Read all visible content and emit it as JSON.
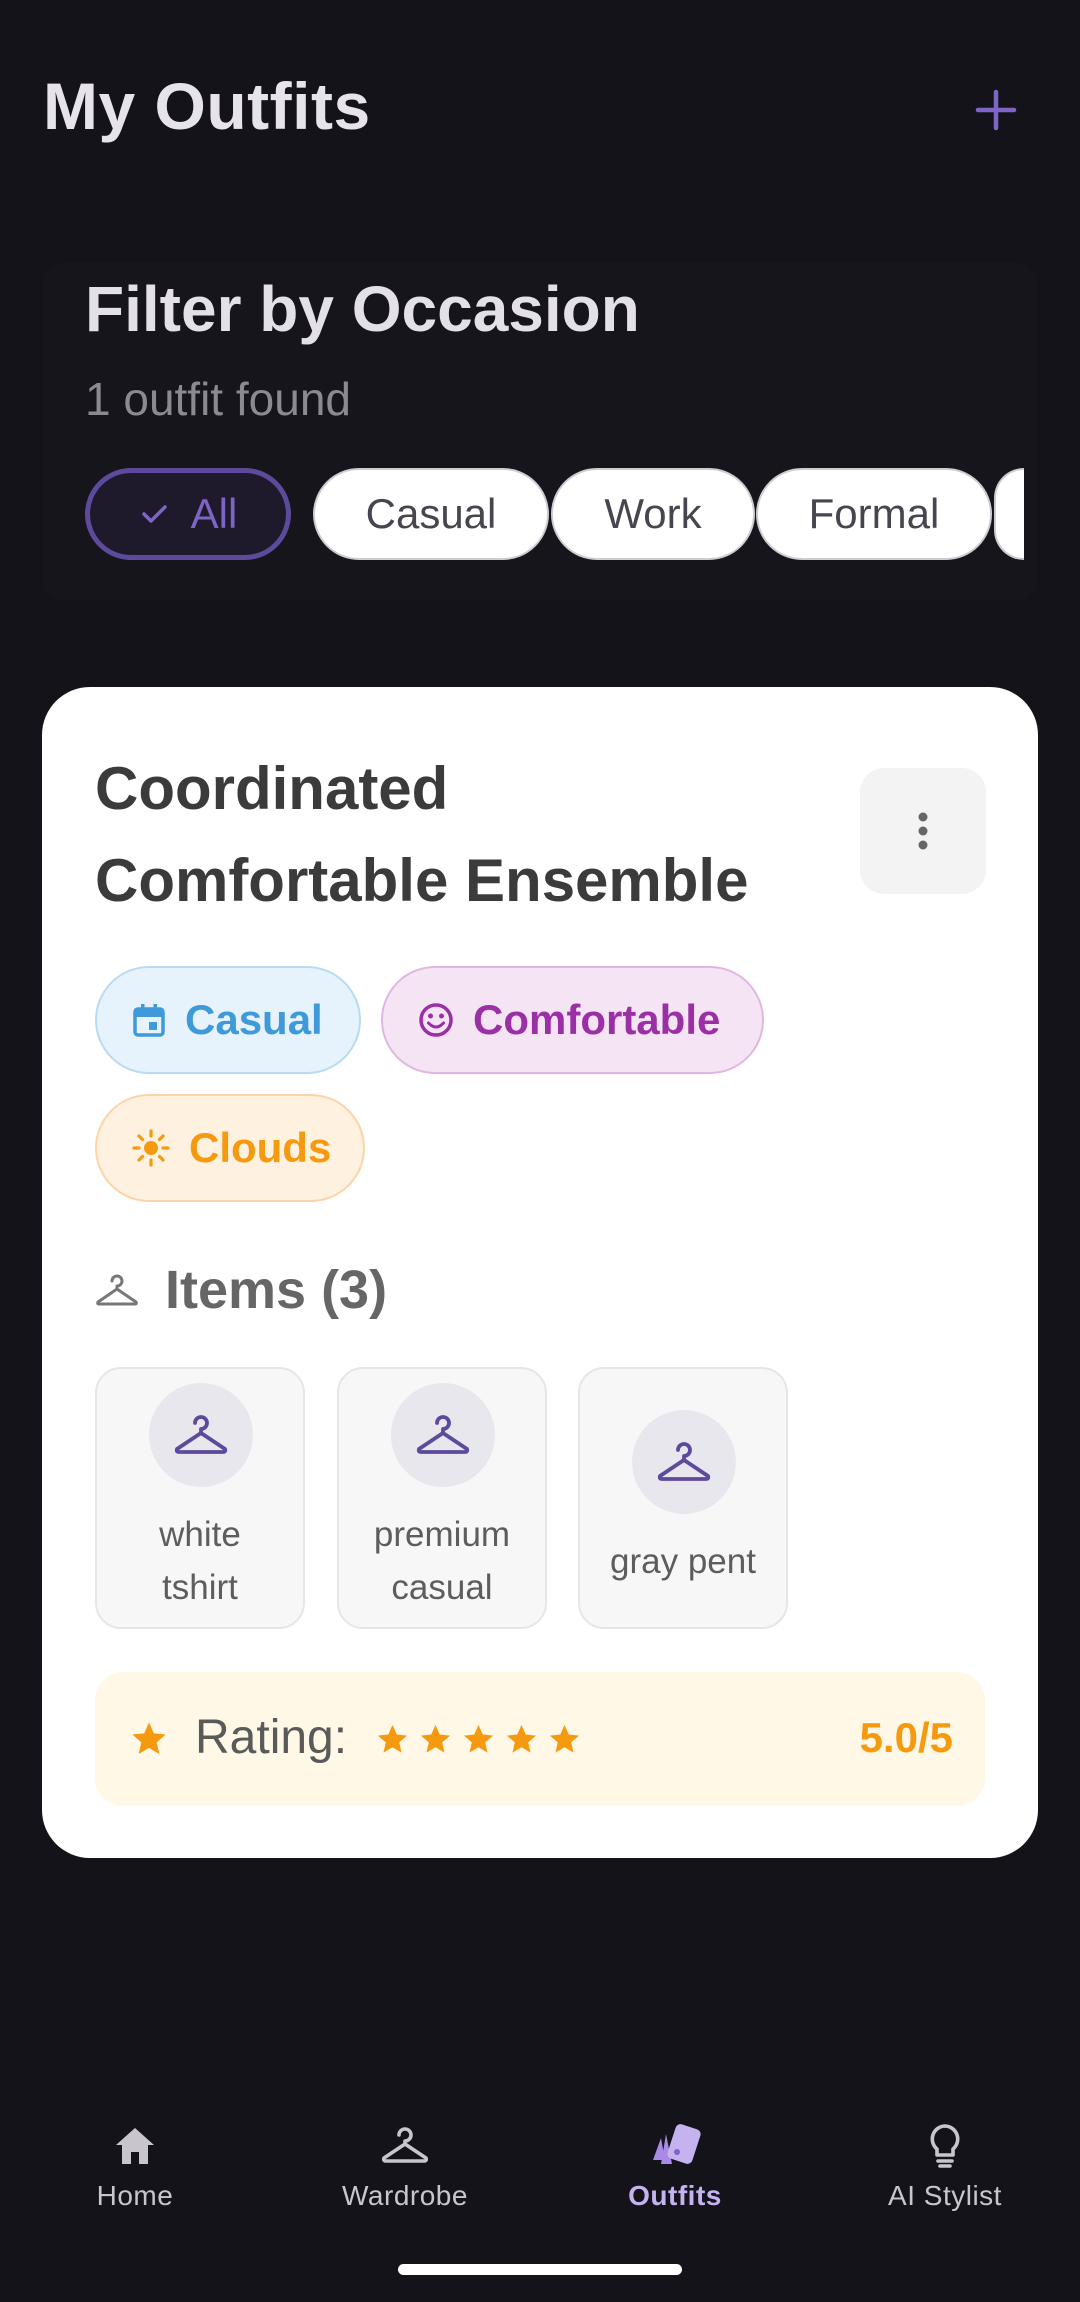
{
  "header": {
    "title": "My Outfits",
    "add_icon": "plus-icon",
    "accent_color": "#7e64c7"
  },
  "filter": {
    "title": "Filter by Occasion",
    "count_text": "1 outfit found",
    "chips": [
      {
        "label": "All",
        "selected": true
      },
      {
        "label": "Casual",
        "selected": false
      },
      {
        "label": "Work",
        "selected": false
      },
      {
        "label": "Formal",
        "selected": false
      }
    ]
  },
  "outfit": {
    "title": "Coordinated Comfortable Ensemble",
    "menu_icon": "more-vert-icon",
    "tags": [
      {
        "label": "Casual",
        "icon": "calendar-icon",
        "color": "#3e9ad9"
      },
      {
        "label": "Comfortable",
        "icon": "smile-icon",
        "color": "#9b2fa6"
      },
      {
        "label": "Clouds",
        "icon": "sun-icon",
        "color": "#f59a0f"
      }
    ],
    "items_heading": "Items (3)",
    "items": [
      {
        "label": "white tshirt",
        "icon": "hanger-icon"
      },
      {
        "label": "premium casual",
        "icon": "hanger-icon"
      },
      {
        "label": "gray pent",
        "icon": "hanger-icon"
      }
    ],
    "rating": {
      "label": "Rating:",
      "stars": 5,
      "value_text": "5.0/5",
      "color": "#f59a0f"
    }
  },
  "nav": {
    "items": [
      {
        "label": "Home",
        "icon": "home-icon",
        "active": false
      },
      {
        "label": "Wardrobe",
        "icon": "hanger-icon",
        "active": false
      },
      {
        "label": "Outfits",
        "icon": "outfits-icon",
        "active": true
      },
      {
        "label": "AI Stylist",
        "icon": "lightbulb-icon",
        "active": false
      }
    ]
  }
}
